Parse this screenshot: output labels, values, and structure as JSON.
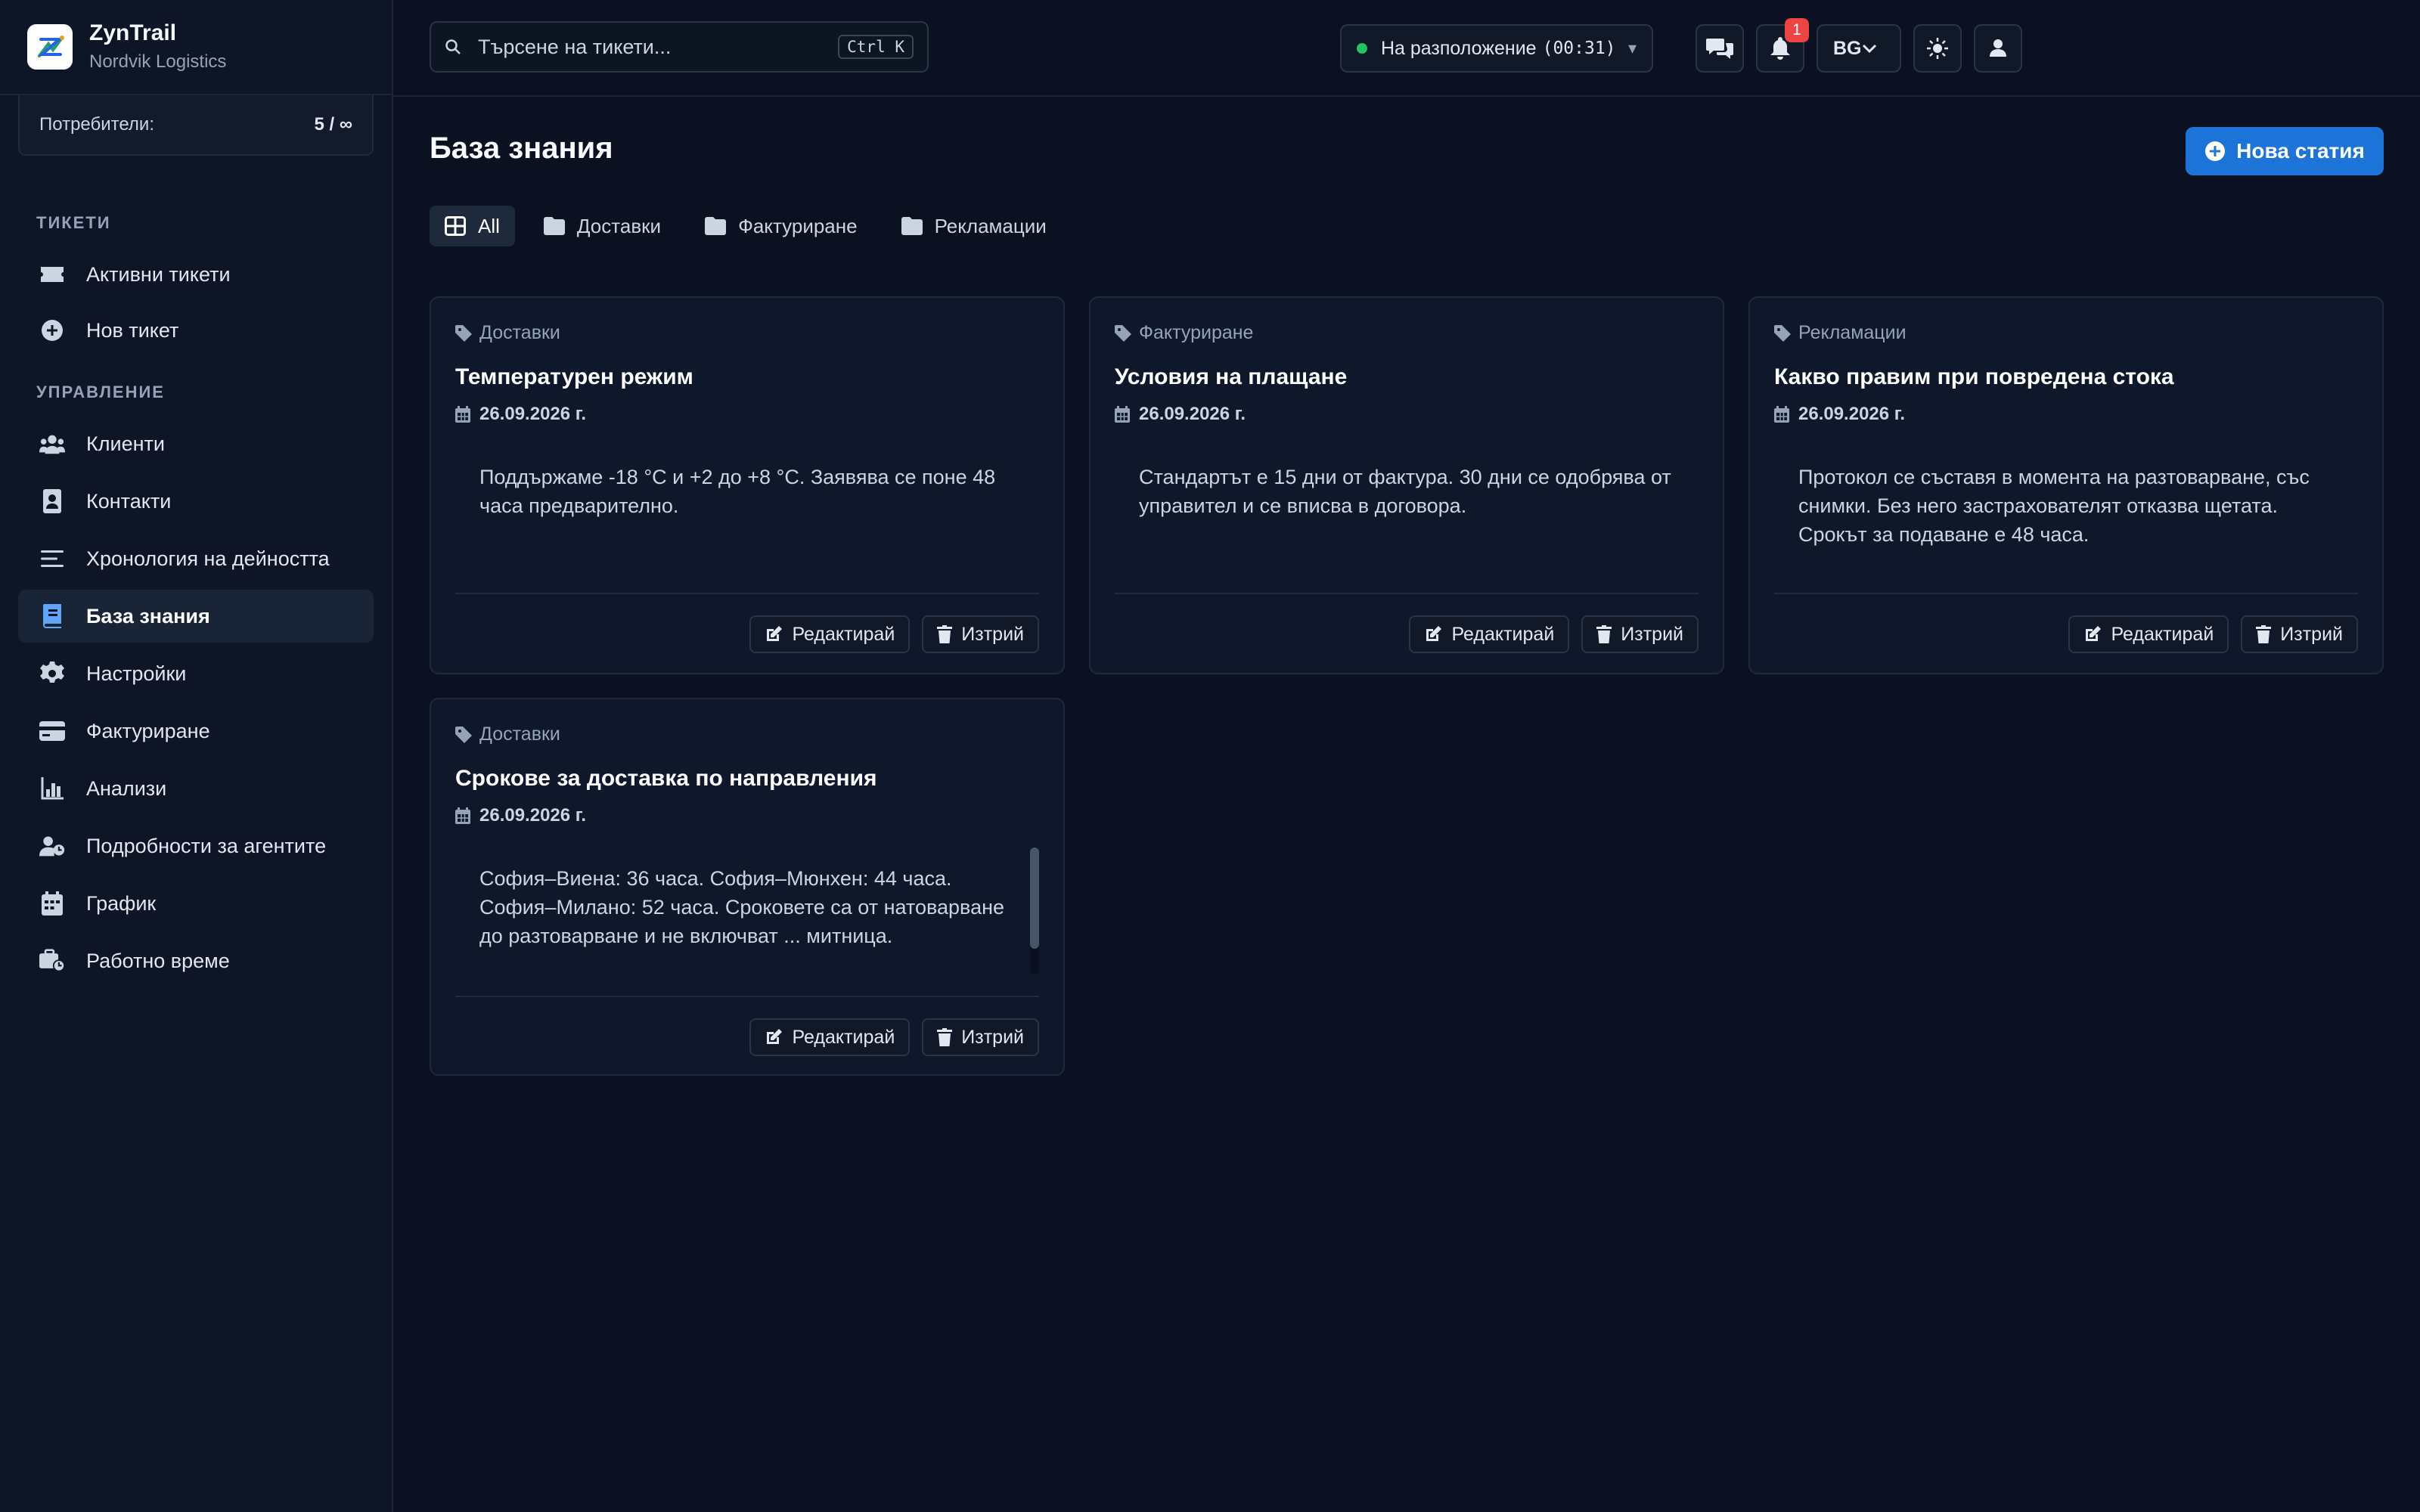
{
  "brand": {
    "name": "ZynTrail",
    "org": "Nordvik Logistics"
  },
  "users": {
    "label": "Потребители:",
    "value": "5 / ∞"
  },
  "sidebar": {
    "section_tickets": "ТИКЕТИ",
    "section_manage": "УПРАВЛЕНИЕ",
    "items": [
      {
        "label": "Активни тикети",
        "icon": "ticket-icon"
      },
      {
        "label": "Нов тикет",
        "icon": "plus-circle-icon"
      },
      {
        "label": "Клиенти",
        "icon": "users-icon"
      },
      {
        "label": "Контакти",
        "icon": "contact-card-icon"
      },
      {
        "label": "Хронология на дейността",
        "icon": "list-icon"
      },
      {
        "label": "База знания",
        "icon": "book-icon",
        "active": true
      },
      {
        "label": "Настройки",
        "icon": "gear-icon"
      },
      {
        "label": "Фактуриране",
        "icon": "credit-card-icon"
      },
      {
        "label": "Анализи",
        "icon": "bar-chart-icon"
      },
      {
        "label": "Подробности за агентите",
        "icon": "user-clock-icon"
      },
      {
        "label": "График",
        "icon": "calendar-icon"
      },
      {
        "label": "Работно време",
        "icon": "briefcase-clock-icon"
      }
    ]
  },
  "topbar": {
    "search_placeholder": "Търсене на тикети...",
    "search_shortcut": "Ctrl K",
    "status_label": "На разположение",
    "status_timer": "(00:31)",
    "status_color": "#22c55e",
    "notifications_count": "1",
    "language": "BG"
  },
  "main": {
    "title": "База знания",
    "new_button": "Нова статия",
    "tabs": [
      {
        "label": "All",
        "icon": "grid-icon",
        "active": true
      },
      {
        "label": "Доставки",
        "icon": "folder-icon"
      },
      {
        "label": "Фактуриране",
        "icon": "folder-icon"
      },
      {
        "label": "Рекламации",
        "icon": "folder-icon"
      }
    ],
    "edit_label": "Редактирай",
    "delete_label": "Изтрий",
    "articles": [
      {
        "category": "Доставки",
        "title": "Температурен режим",
        "date": "26.09.2026 г.",
        "body": "Поддържаме -18 °C и +2 до +8 °C. Заявява се поне 48 часа предварително."
      },
      {
        "category": "Фактуриране",
        "title": "Условия на плащане",
        "date": "26.09.2026 г.",
        "body": "Стандартът е 15 дни от фактура. 30 дни се одобрява от управител и се вписва в договора."
      },
      {
        "category": "Рекламации",
        "title": "Какво правим при повредена стока",
        "date": "26.09.2026 г.",
        "body": "Протокол се съставя в момента на разтоварване, със снимки. Без него застрахователят отказва щетата. Срокът за подаване е 48 часа."
      },
      {
        "category": "Доставки",
        "title": "Срокове за доставка по направления",
        "date": "26.09.2026 г.",
        "body": "София–Виена: 36 часа. София–Мюнхен: 44 часа. София–Милано: 52 часа. Сроковете са от натоварване до разтоварване и не включват ... митница."
      }
    ]
  },
  "colors": {
    "accent": "#1d74d8",
    "active_nav_icon": "#60a5fa",
    "badge": "#ef4444"
  }
}
